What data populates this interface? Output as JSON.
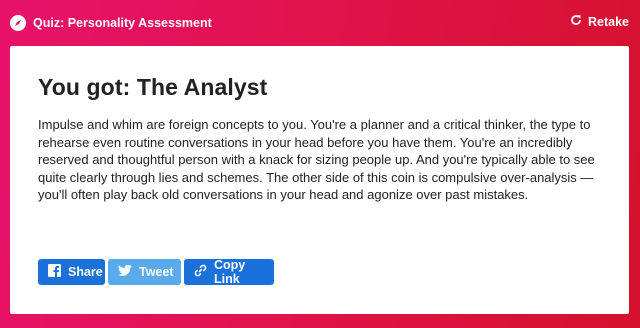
{
  "header": {
    "quiz_title": "Quiz: Personality Assessment",
    "retake_label": "Retake"
  },
  "result": {
    "title": "You got: The Analyst",
    "description": "Impulse and whim are foreign concepts to you. You're a planner and a critical thinker, the type to rehearse even routine conversations in your head before you have them. You're an incredibly reserved and thoughtful person with a knack for sizing people up. And you're typically able to see quite clearly through lies and schemes. The other side of this coin is compulsive over-analysis — you'll often play back old conversations in your head and agonize over past mistakes."
  },
  "share": {
    "share_label": "Share",
    "tweet_label": "Tweet",
    "copy_link_label": "Copy Link"
  },
  "icons": {
    "quiz": "quiz-compass-icon",
    "retake": "refresh-icon",
    "share": "facebook-icon",
    "tweet": "twitter-icon",
    "copy_link": "link-icon"
  },
  "colors": {
    "background_start": "#e8126b",
    "background_end": "#d4122c",
    "facebook": "#1a71d9",
    "twitter": "#5aabee"
  }
}
